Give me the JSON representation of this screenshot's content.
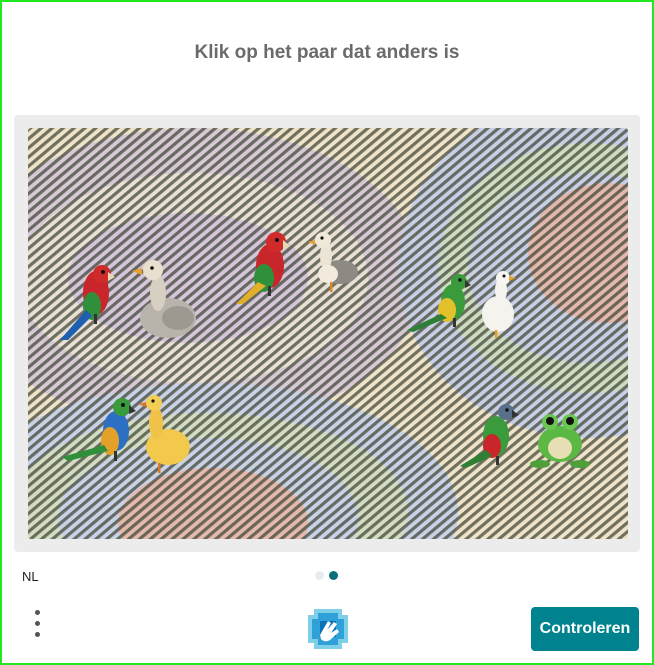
{
  "challenge": {
    "prompt": "Klik op het paar dat anders is",
    "pairs": [
      {
        "id": "parrot-duck-grey",
        "left": "parrot-red",
        "right": "duck-grey"
      },
      {
        "id": "parrot-goose",
        "left": "parrot-red",
        "right": "goose-grey"
      },
      {
        "id": "parrot-duck-white",
        "left": "parrot-green",
        "right": "duck-white"
      },
      {
        "id": "parrot-duck-yellow",
        "left": "parrot-blue",
        "right": "duck-yellow"
      },
      {
        "id": "parrot-frog",
        "left": "parrot-green",
        "right": "frog"
      }
    ]
  },
  "footer": {
    "language": "NL",
    "pagination": {
      "total": 2,
      "current": 2
    },
    "menu_icon": "more-vertical-icon",
    "logo_icon": "hcaptcha-hand-logo",
    "verify_label": "Controleren"
  },
  "colors": {
    "border": "#22e822",
    "accent": "#00838f",
    "dot_active": "#0a6f7a",
    "dot_inactive": "#e6ecef",
    "prompt_text": "#6b6b6b"
  }
}
